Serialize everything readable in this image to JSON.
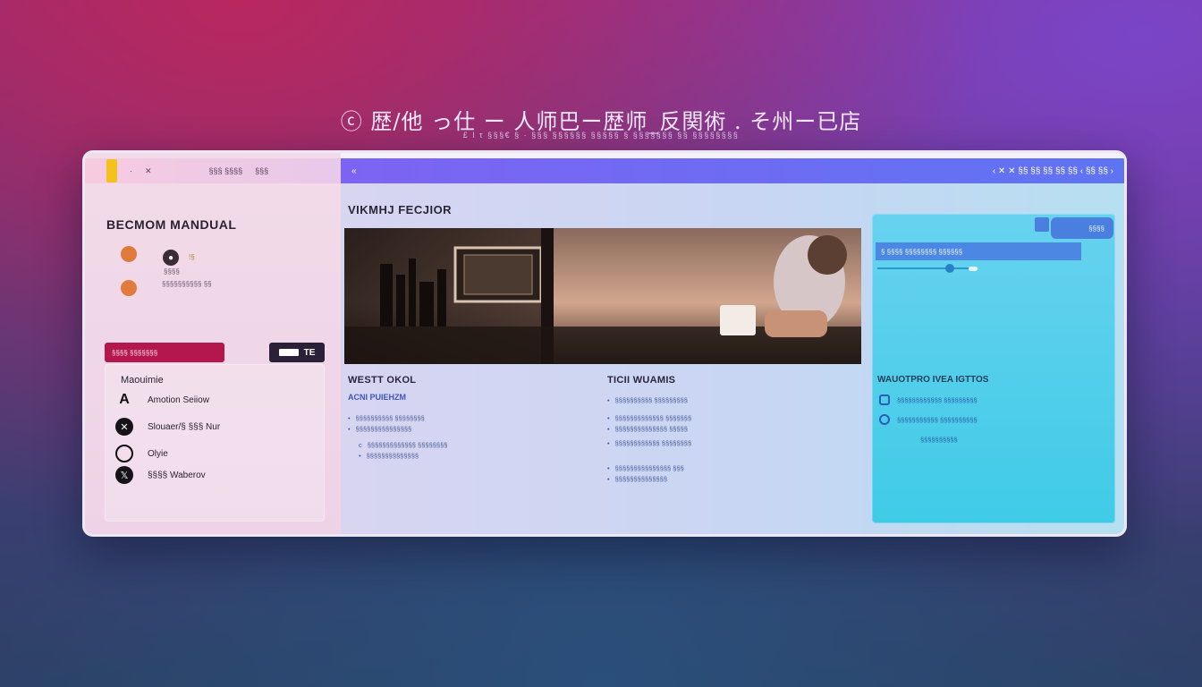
{
  "hero": {
    "title": "ⓒ 歴/他 っ仕 ー 人师巴ー歴师_反関術 . そ州ー已店",
    "subtitle": "£ ǀ τ §§§€ § · §§§ §§§§§§ §§§§§ § §§§§§§§ §§ §§§§§§§§"
  },
  "sidebar": {
    "top_items": [
      "·",
      "✕",
      "§§§ §§§§",
      "§§§"
    ],
    "title": "BECMOM MANDUAL",
    "mini1": "ǃ§",
    "mini2": "§§§§",
    "mini3": "§§§§§§§§§§ §§",
    "red_button": "§§§§ §§§§§§§",
    "dark_button": "TE",
    "section_title": "Maouimie",
    "options": [
      "Amotion Seiiow",
      "Slouaer/§ §§§ Nur",
      "Olyie",
      "§§§§ Waberov"
    ]
  },
  "main": {
    "crumb": "«",
    "toolbar": "‹ ✕ ✕ §§ §§ §§ §§ §§ ‹ §§ §§ ›",
    "title": "VIKMHJ FECJIOR",
    "col1": {
      "title": "WESTT OKOL",
      "subtitle": "ACNI PUIEHZM",
      "lines": [
        "§§§§§§§§§§ §§§§§§§§",
        "§§§§§§§§§§§§§§§",
        "§§§§§§§§§§§§§ §§§§§§§§",
        "§§§§§§§§§§§§§§"
      ]
    },
    "col2": {
      "title": "TICII WUAMIS",
      "lines": [
        "§§§§§§§§§§ §§§§§§§§§",
        "§§§§§§§§§§§§§ §§§§§§§",
        "§§§§§§§§§§§§§§ §§§§§",
        "§§§§§§§§§§§§ §§§§§§§§",
        "§§§§§§§§§§§§§§§ §§§",
        "§§§§§§§§§§§§§§"
      ]
    }
  },
  "right_panel": {
    "button_label": "§§§§",
    "bar_text": "§ §§§§ §§§§§§§§ §§§§§§",
    "title": "WAUOTPRO IVEA IGTTOS",
    "rows": [
      "§§§§§§§§§§§§ §§§§§§§§§",
      "§§§§§§§§§§§ §§§§§§§§§§",
      "§§§§§§§§§§"
    ]
  },
  "colors": {
    "accent_purple": "#7d63f4",
    "accent_blue": "#5f74f2",
    "cyan_panel": "#3fcbe7",
    "brand_red": "#b3174e",
    "yellow": "#f3c21b"
  }
}
